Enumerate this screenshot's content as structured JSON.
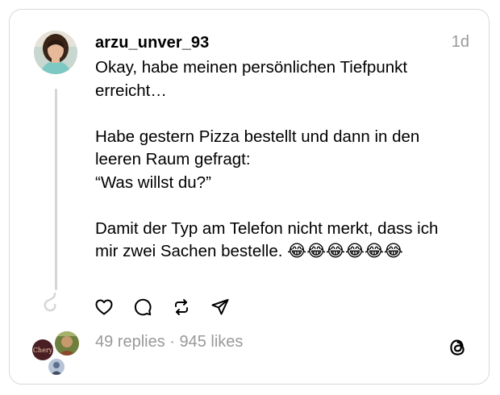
{
  "post": {
    "username": "arzu_unver_93",
    "time": "1d",
    "lines": [
      "Okay, habe meinen persönlichen Tiefpunkt",
      "erreicht…",
      "",
      "Habe gestern Pizza bestellt und dann in den",
      "leeren Raum gefragt:",
      "“Was willst du?”",
      "",
      "Damit der Typ am Telefon nicht merkt, dass ich",
      "mir zwei Sachen bestelle. 😂😂😂😂😂😂"
    ]
  },
  "actions": [
    {
      "icon": "heart-icon"
    },
    {
      "icon": "comment-icon"
    },
    {
      "icon": "repost-icon"
    },
    {
      "icon": "share-icon"
    }
  ],
  "stats": {
    "text": "49 replies · 945 likes"
  },
  "reply_avatars": [
    {
      "label": "Chery"
    }
  ],
  "colors": {
    "text": "#000000",
    "muted": "#999999",
    "border": "#d9d9d9",
    "thread_line": "#d6d6d6"
  }
}
